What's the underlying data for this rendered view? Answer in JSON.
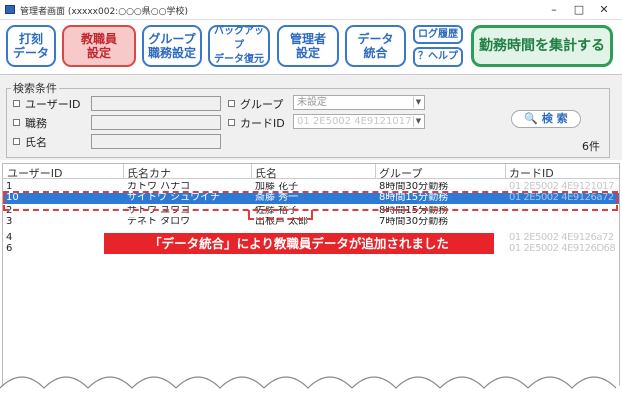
{
  "window": {
    "title": "管理者画面 (xxxxx002:○○○県○○学校)",
    "min": "–",
    "max": "□",
    "close": "✕"
  },
  "toolbar": {
    "buttons": [
      {
        "line1": "打刻",
        "line2": "データ"
      },
      {
        "line1": "教職員",
        "line2": "設定"
      },
      {
        "line1": "グループ",
        "line2": "職務設定"
      },
      {
        "line1": "バックアップ",
        "line2": "データ復元"
      },
      {
        "line1": "管理者",
        "line2": "設定"
      },
      {
        "line1": "データ",
        "line2": "統合"
      }
    ],
    "log": "ログ履歴",
    "help": "？ヘルプ",
    "total": "勤務時間を集計する"
  },
  "search": {
    "title": "検索条件",
    "user_id_label": "ユーザーID",
    "duty_label": "職務",
    "name_label": "氏名",
    "group_label": "グループ",
    "group_value": "未設定",
    "card_label": "カードID",
    "card_value": "01 2E5002 4E9121017",
    "button": "🔍 検 索",
    "count": "6件"
  },
  "table": {
    "headers": [
      "ユーザーID",
      "氏名カナ",
      "氏名",
      "グループ",
      "カードID"
    ],
    "rows": [
      {
        "id": "1",
        "kana": "カトウ ハナコ",
        "name": "加藤 花子",
        "group": "8時間30分勤務",
        "card": "01 2E5002 4E9121017"
      },
      {
        "id": "10",
        "kana": "サイトウ シュウイチ",
        "name": "斎藤 秀一",
        "group": "8時間15分勤務",
        "card": "01 2E5002 4E9126a72"
      },
      {
        "id": "2",
        "kana": "サトウ ユウコ",
        "name": "佐藤 裕子",
        "group": "8時間15分勤務",
        "card": ""
      },
      {
        "id": "3",
        "kana": "デネト タロウ",
        "name": "出根戸 太郎",
        "group": "7時間30分勤務",
        "card": ""
      },
      {
        "id": "4",
        "kana": "",
        "name": "",
        "group": "",
        "card": "01 2E5002 4E9126a72"
      },
      {
        "id": "6",
        "kana": "",
        "name": "",
        "group": "",
        "card": "01 2E5002 4E9126D68"
      }
    ]
  },
  "notice": "「データ統合」により教職員データが追加されました",
  "colors": {
    "accent": "#3a78c8",
    "active": "#d94848",
    "total": "#2e9d5a",
    "selected": "#2d7ad6",
    "notice": "#e7242a"
  }
}
